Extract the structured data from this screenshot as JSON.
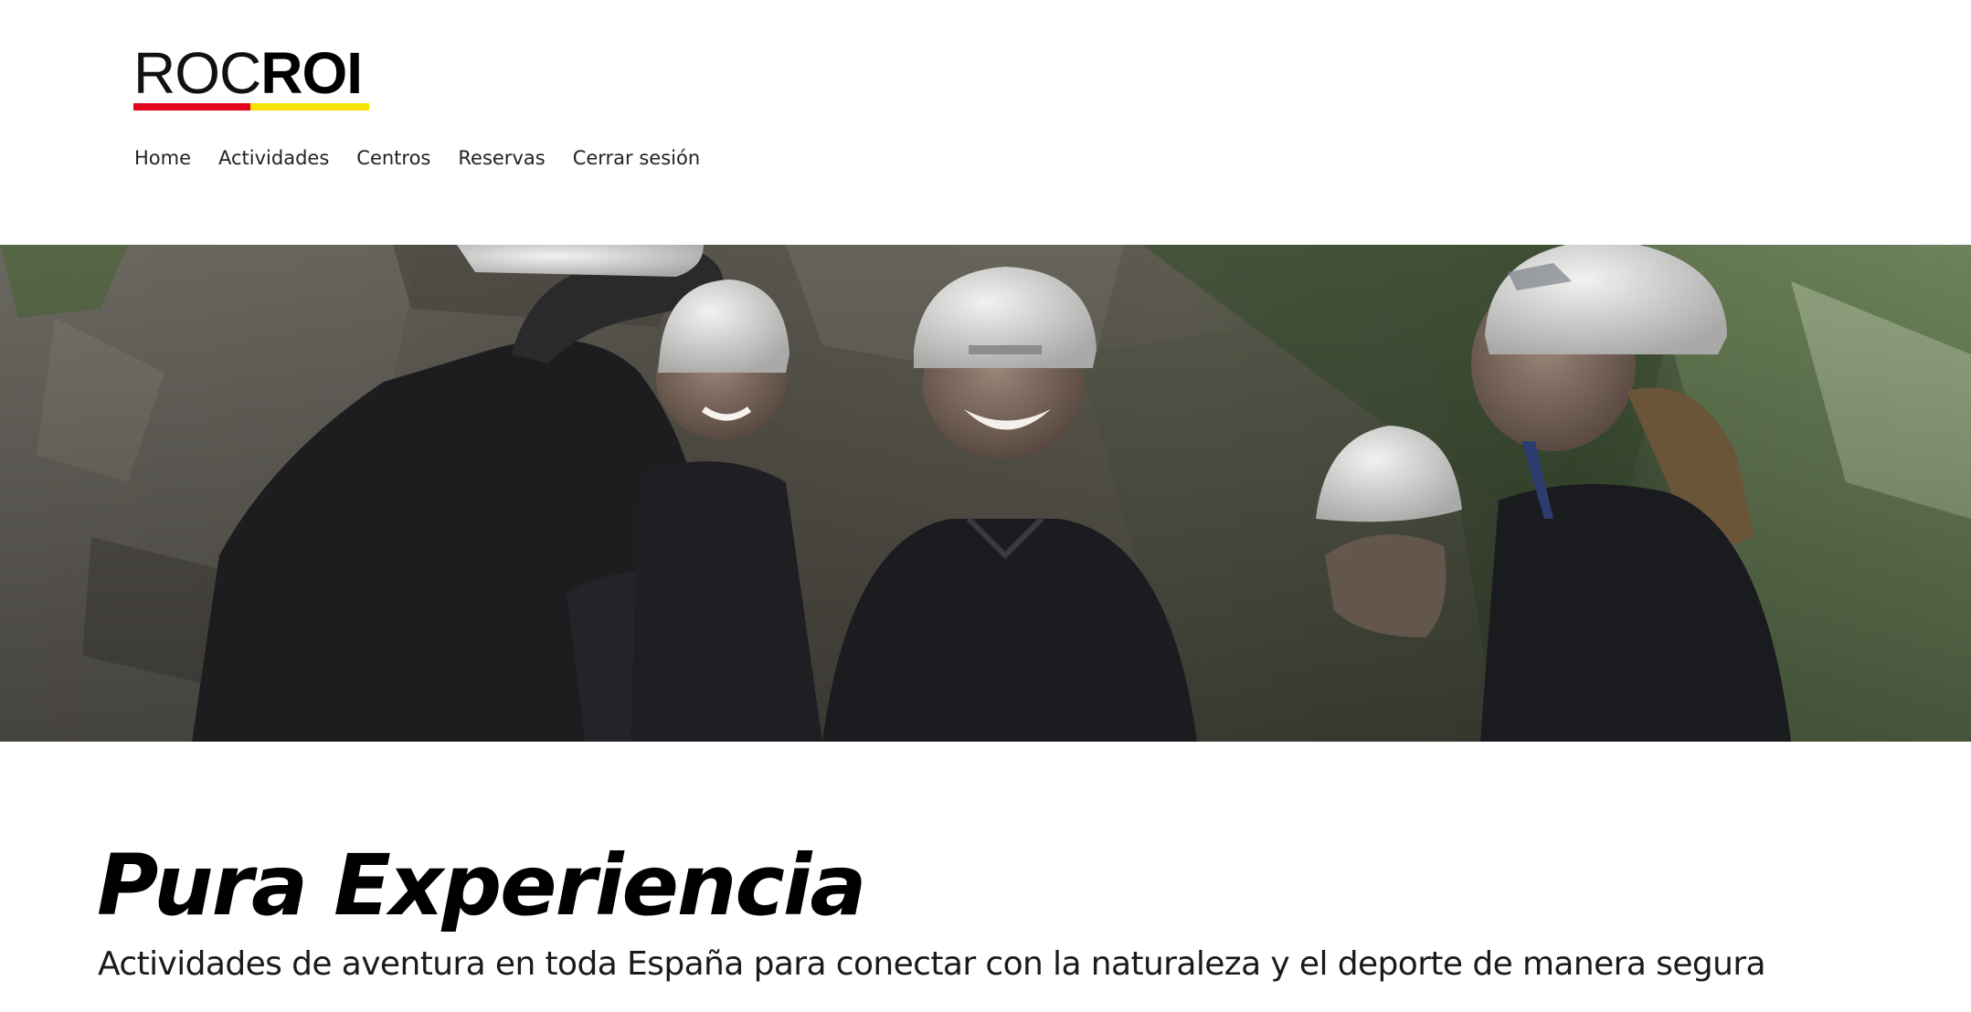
{
  "brand": {
    "logo_part_light": "ROC",
    "logo_part_bold": "ROI",
    "colors": {
      "red": "#e3051b",
      "yellow": "#f7e200",
      "text": "#000000"
    }
  },
  "nav": {
    "items": [
      {
        "label": "Home"
      },
      {
        "label": "Actividades"
      },
      {
        "label": "Centros"
      },
      {
        "label": "Reservas"
      },
      {
        "label": "Cerrar sesión"
      }
    ]
  },
  "hero": {
    "image": "group-of-climbers-in-helmets-laughing-in-canyon"
  },
  "intro": {
    "headline": "Pura Experiencia",
    "subline": "Actividades de aventura en toda España para conectar con la naturaleza y el deporte de manera segura"
  }
}
